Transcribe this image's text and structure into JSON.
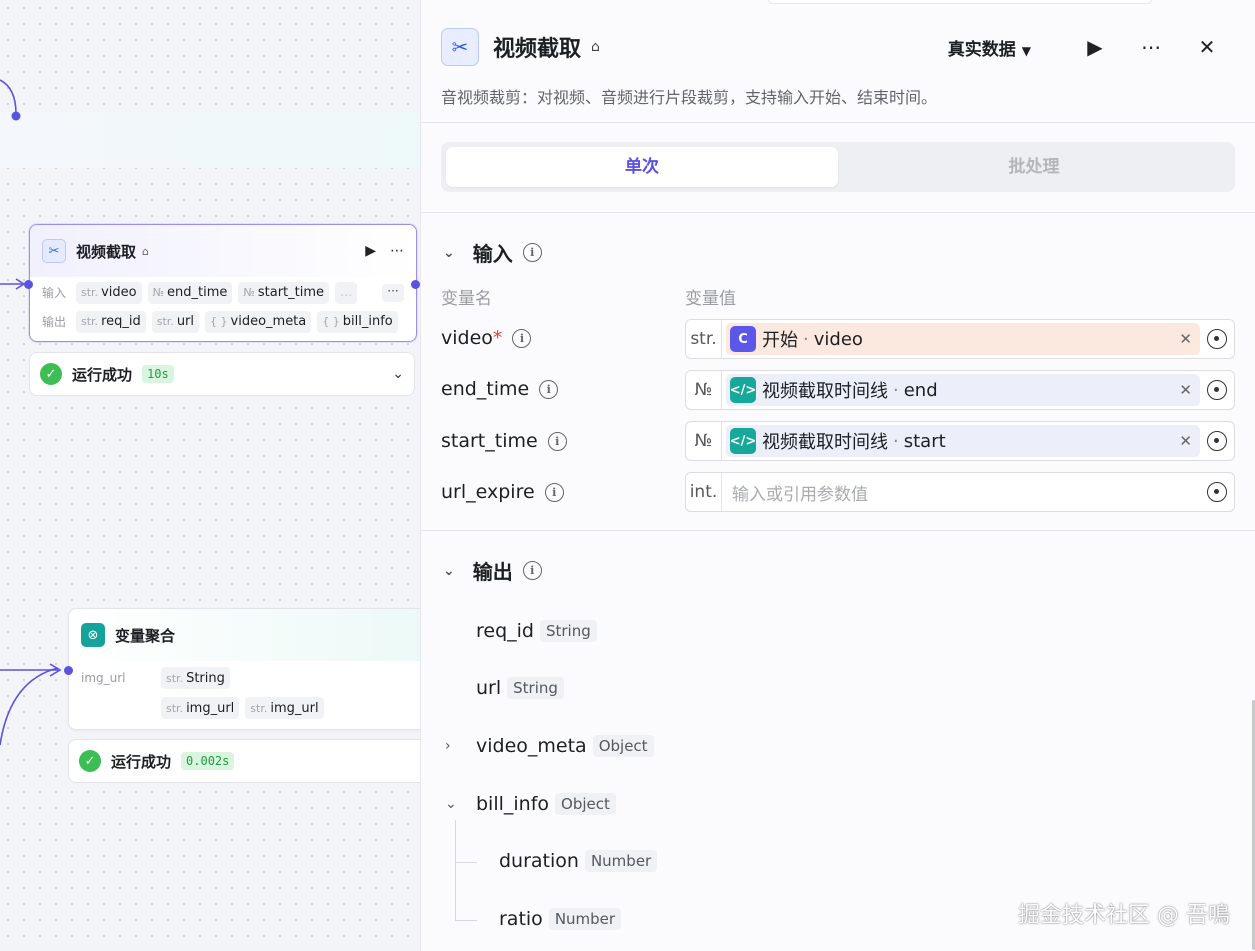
{
  "canvas": {
    "node1": {
      "title": "视频截取",
      "input_label": "输入",
      "output_label": "输出",
      "inputs": [
        {
          "type": "str.",
          "name": "video"
        },
        {
          "type": "№",
          "name": "end_time"
        },
        {
          "type": "№",
          "name": "start_time"
        },
        {
          "type": "",
          "name": "..."
        }
      ],
      "outputs": [
        {
          "type": "str.",
          "name": "req_id"
        },
        {
          "type": "str.",
          "name": "url"
        },
        {
          "type": "{ }",
          "name": "video_meta"
        },
        {
          "type": "{ }",
          "name": "bill_info"
        }
      ],
      "more": "···"
    },
    "status1": {
      "text": "运行成功",
      "duration": "10s"
    },
    "node2": {
      "title": "变量聚合",
      "var_label": "img_url",
      "chips": [
        {
          "type": "str.",
          "name": "String"
        },
        {
          "type": "str.",
          "name": "img_url"
        },
        {
          "type": "str.",
          "name": "img_url"
        }
      ]
    },
    "status2": {
      "text": "运行成功",
      "duration": "0.002s"
    }
  },
  "panel": {
    "title": "视频截取",
    "description": "音视频裁剪：对视频、音频进行片段裁剪，支持输入开始、结束时间。",
    "data_mode": "真实数据",
    "tabs": [
      "单次",
      "批处理"
    ],
    "input_section": {
      "title": "输入",
      "col_name": "变量名",
      "col_value": "变量值",
      "rows": [
        {
          "name": "video",
          "required": "*",
          "type": "str.",
          "ref_source": "开始",
          "ref_field": "video"
        },
        {
          "name": "end_time",
          "required": "",
          "type": "№",
          "ref_source": "视频截取时间线",
          "ref_field": "end"
        },
        {
          "name": "start_time",
          "required": "",
          "type": "№",
          "ref_source": "视频截取时间线",
          "ref_field": "start"
        },
        {
          "name": "url_expire",
          "required": "",
          "type": "int.",
          "placeholder": "输入或引用参数值"
        }
      ]
    },
    "output_section": {
      "title": "输出",
      "rows": [
        {
          "name": "req_id",
          "type": "String"
        },
        {
          "name": "url",
          "type": "String"
        },
        {
          "name": "video_meta",
          "type": "Object"
        },
        {
          "name": "bill_info",
          "type": "Object"
        },
        {
          "name": "duration",
          "type": "Number"
        },
        {
          "name": "ratio",
          "type": "Number"
        }
      ]
    }
  },
  "watermark": "掘金技术社区 @ 吾鳴",
  "colors": {
    "accent": "#5c4fe3",
    "success": "#3dbe55",
    "teal": "#16a89a"
  }
}
